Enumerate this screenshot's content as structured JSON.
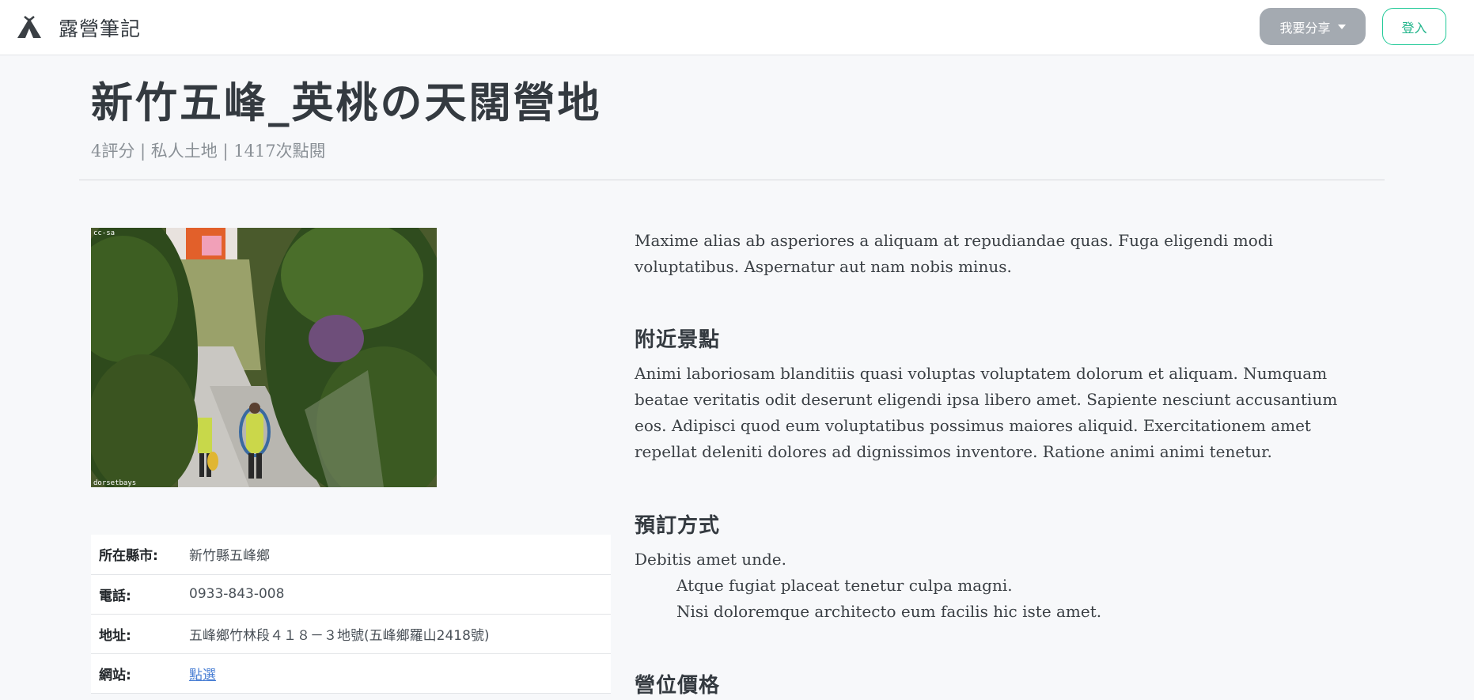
{
  "navbar": {
    "brand_name": "露營筆記",
    "share_label": "我要分享",
    "login_label": "登入"
  },
  "page": {
    "title": "新竹五峰_英桃の天闊營地",
    "subtitle": "4評分 | 私人土地 | 1417次點閱"
  },
  "photo": {
    "top_left_mark": "cc-sa",
    "bottom_left_mark": "dorsetbays"
  },
  "info": {
    "rows": [
      {
        "key": "所在縣市:",
        "value": "新竹縣五峰鄉"
      },
      {
        "key": "電話:",
        "value": "0933-843-008"
      },
      {
        "key": "地址:",
        "value": "五峰鄉竹林段４１８－３地號(五峰鄉羅山2418號)"
      },
      {
        "key": "網站:",
        "value": "點選"
      }
    ]
  },
  "content": {
    "intro": "Maxime alias ab asperiores a aliquam at repudiandae quas. Fuga eligendi modi voluptatibus. Aspernatur aut nam nobis minus.",
    "nearby_heading": "附近景點",
    "nearby_text": "Animi laboriosam blanditiis quasi voluptas voluptatem dolorum et aliquam. Numquam beatae veritatis odit deserunt eligendi ipsa libero amet. Sapiente nesciunt accusantium eos. Adipisci quod eum voluptatibus possimus maiores aliquid. Exercitationem amet repellat deleniti dolores ad dignissimos inventore. Ratione animi animi tenetur.",
    "booking_heading": "預訂方式",
    "booking_lines": [
      "Debitis amet unde.",
      "Atque fugiat placeat tenetur culpa magni.",
      "Nisi doloremque architecto eum facilis hic iste amet."
    ],
    "price_heading": "營位價格"
  }
}
